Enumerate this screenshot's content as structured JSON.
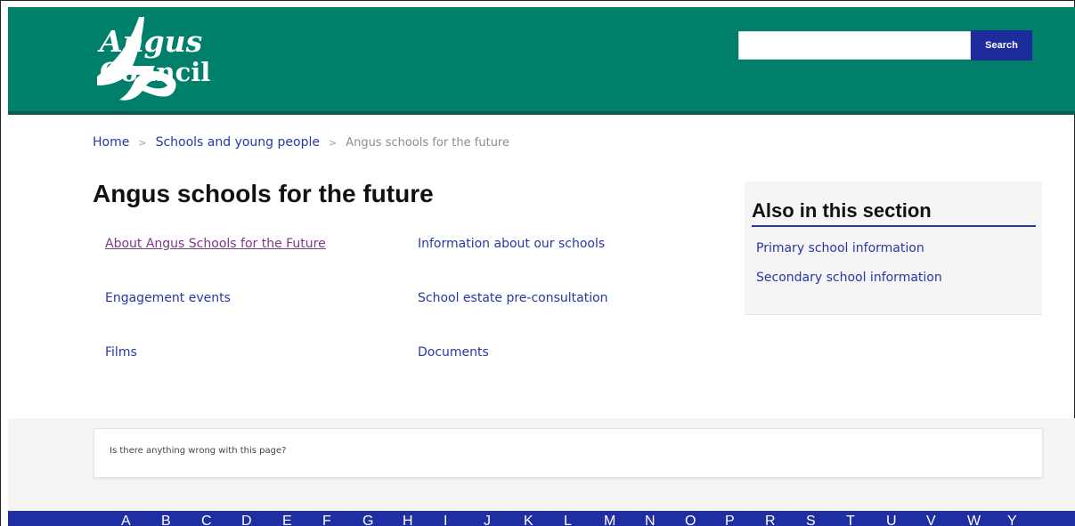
{
  "header": {
    "logo": {
      "line1": "Angus",
      "line2": "Council",
      "brand_color": "#00806a"
    },
    "search": {
      "placeholder": "",
      "value": "",
      "button_label": "Search",
      "button_color": "#1e2b9b"
    }
  },
  "breadcrumb": {
    "items": [
      "Home",
      "Schools and young people"
    ],
    "current": "Angus schools for the future",
    "separator": ">"
  },
  "main": {
    "title": "Angus schools for the future",
    "links": [
      "About Angus Schools for the Future",
      "Information about our schools",
      "Engagement events",
      "School estate pre-consultation",
      "Films",
      "Documents"
    ]
  },
  "aside": {
    "title": "Also in this section",
    "links": [
      "Primary school information",
      "Secondary school information"
    ]
  },
  "feedback": {
    "prompt": "Is there anything wrong with this page?"
  },
  "az_index": {
    "letters": [
      "A",
      "B",
      "C",
      "D",
      "E",
      "F",
      "G",
      "H",
      "I",
      "J",
      "K",
      "L",
      "M",
      "N",
      "O",
      "P",
      "R",
      "S",
      "T",
      "U",
      "V",
      "W",
      "Y"
    ],
    "bar_color": "#1f2ea0"
  },
  "colors": {
    "link": "#2837a6",
    "visited_link": "#7a3a86",
    "accent_rule": "#2837a6"
  }
}
